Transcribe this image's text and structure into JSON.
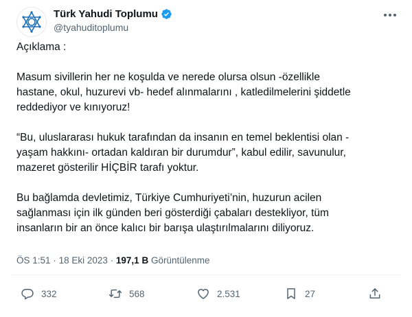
{
  "author": {
    "display_name": "Türk Yahudi Toplumu",
    "handle": "@tyahuditoplumu",
    "avatar_icon": "star-of-david-logo",
    "verified_icon": "verified-badge-icon",
    "verified_color": "#1d9bf0"
  },
  "tweet": {
    "paragraphs": [
      "Açıklama :",
      "Masum sivillerin her ne koşulda ve nerede olursa olsun -özellikle\nhastane, okul, huzurevi vb- hedef alınmalarını , katledilmelerini şiddetle\nreddediyor ve kınıyoruz!",
      "“Bu, uluslararası hukuk tarafından da insanın en temel beklentisi olan -\nyaşam hakkını- ortadan kaldıran bir durumdur”, kabul edilir, savunulur,\nmazeret gösterilir HİÇBİR tarafı yoktur.",
      "Bu bağlamda devletimiz, Türkiye Cumhuriyeti’nin, huzurun acilen\nsağlanması için ilk günden beri gösterdiği çabaları destekliyor, tüm\ninsanların bir an önce kalıcı bir barışa ulaştırılmalarını  diliyoruz."
    ]
  },
  "meta": {
    "time": "ÖS 1:51",
    "separator": "·",
    "date": "18 Eki 2023",
    "views_count": "197,1 B",
    "views_label": "Görüntülenme"
  },
  "actions": {
    "replies": "332",
    "reposts": "568",
    "likes": "2.531",
    "bookmarks": "27"
  }
}
